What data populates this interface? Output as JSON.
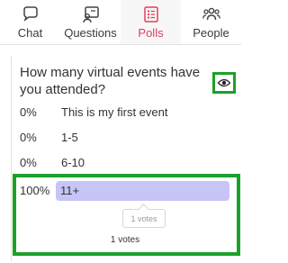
{
  "tabs": [
    {
      "label": "Chat",
      "icon": "chat-icon"
    },
    {
      "label": "Questions",
      "icon": "questions-icon"
    },
    {
      "label": "Polls",
      "icon": "polls-icon",
      "active": true
    },
    {
      "label": "People",
      "icon": "people-icon"
    }
  ],
  "poll": {
    "question": "How many virtual events have you attended?",
    "options": [
      {
        "percent": "0%",
        "label": "This is my first event",
        "fraction": 0
      },
      {
        "percent": "0%",
        "label": "1-5",
        "fraction": 0
      },
      {
        "percent": "0%",
        "label": "6-10",
        "fraction": 0
      },
      {
        "percent": "100%",
        "label": "11+",
        "fraction": 1.0
      }
    ],
    "tooltip": "1 votes",
    "total_votes": "1 votes"
  },
  "colors": {
    "active_tab": "#e0405a",
    "bar_fill": "#c6c5f6",
    "highlight_border": "#1aa12a"
  }
}
